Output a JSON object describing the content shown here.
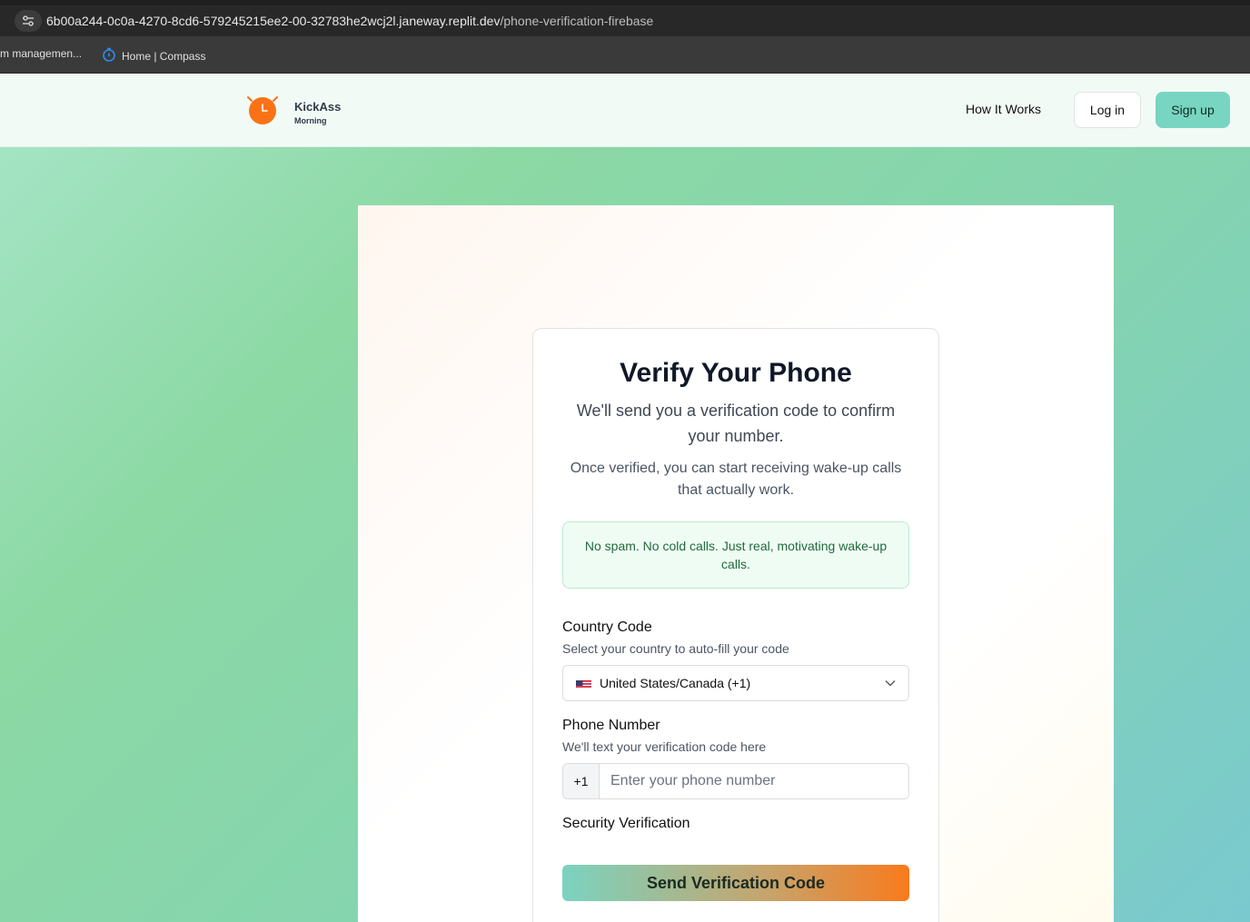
{
  "browser": {
    "url_host": "6b00a244-0c0a-4270-8cd6-579245215ee2-00-32783he2wcj2l.janeway.replit.dev",
    "url_path": "/phone-verification-firebase",
    "bookmarks": [
      {
        "label": "m managemen...",
        "icon": "none"
      },
      {
        "label": "Home | Compass",
        "icon": "compass-icon"
      }
    ]
  },
  "header": {
    "brand_name": "KickAss",
    "brand_sub": "Morning",
    "nav_how": "How It Works",
    "login_label": "Log in",
    "signup_label": "Sign up",
    "accent": "#78d5c1"
  },
  "card": {
    "title": "Verify Your Phone",
    "subtitle": "We'll send you a verification code to confirm your number.",
    "note": "Once verified, you can start receiving wake-up calls that actually work.",
    "notice": "No spam. No cold calls. Just real, motivating wake-up calls.",
    "country": {
      "label": "Country Code",
      "hint": "Select your country to auto-fill your code",
      "selected": "United States/Canada (+1)"
    },
    "phone": {
      "label": "Phone Number",
      "hint": "We'll text your verification code here",
      "prefix": "+1",
      "placeholder": "Enter your phone number",
      "value": ""
    },
    "security_label": "Security Verification",
    "send_label": "Send Verification Code"
  }
}
